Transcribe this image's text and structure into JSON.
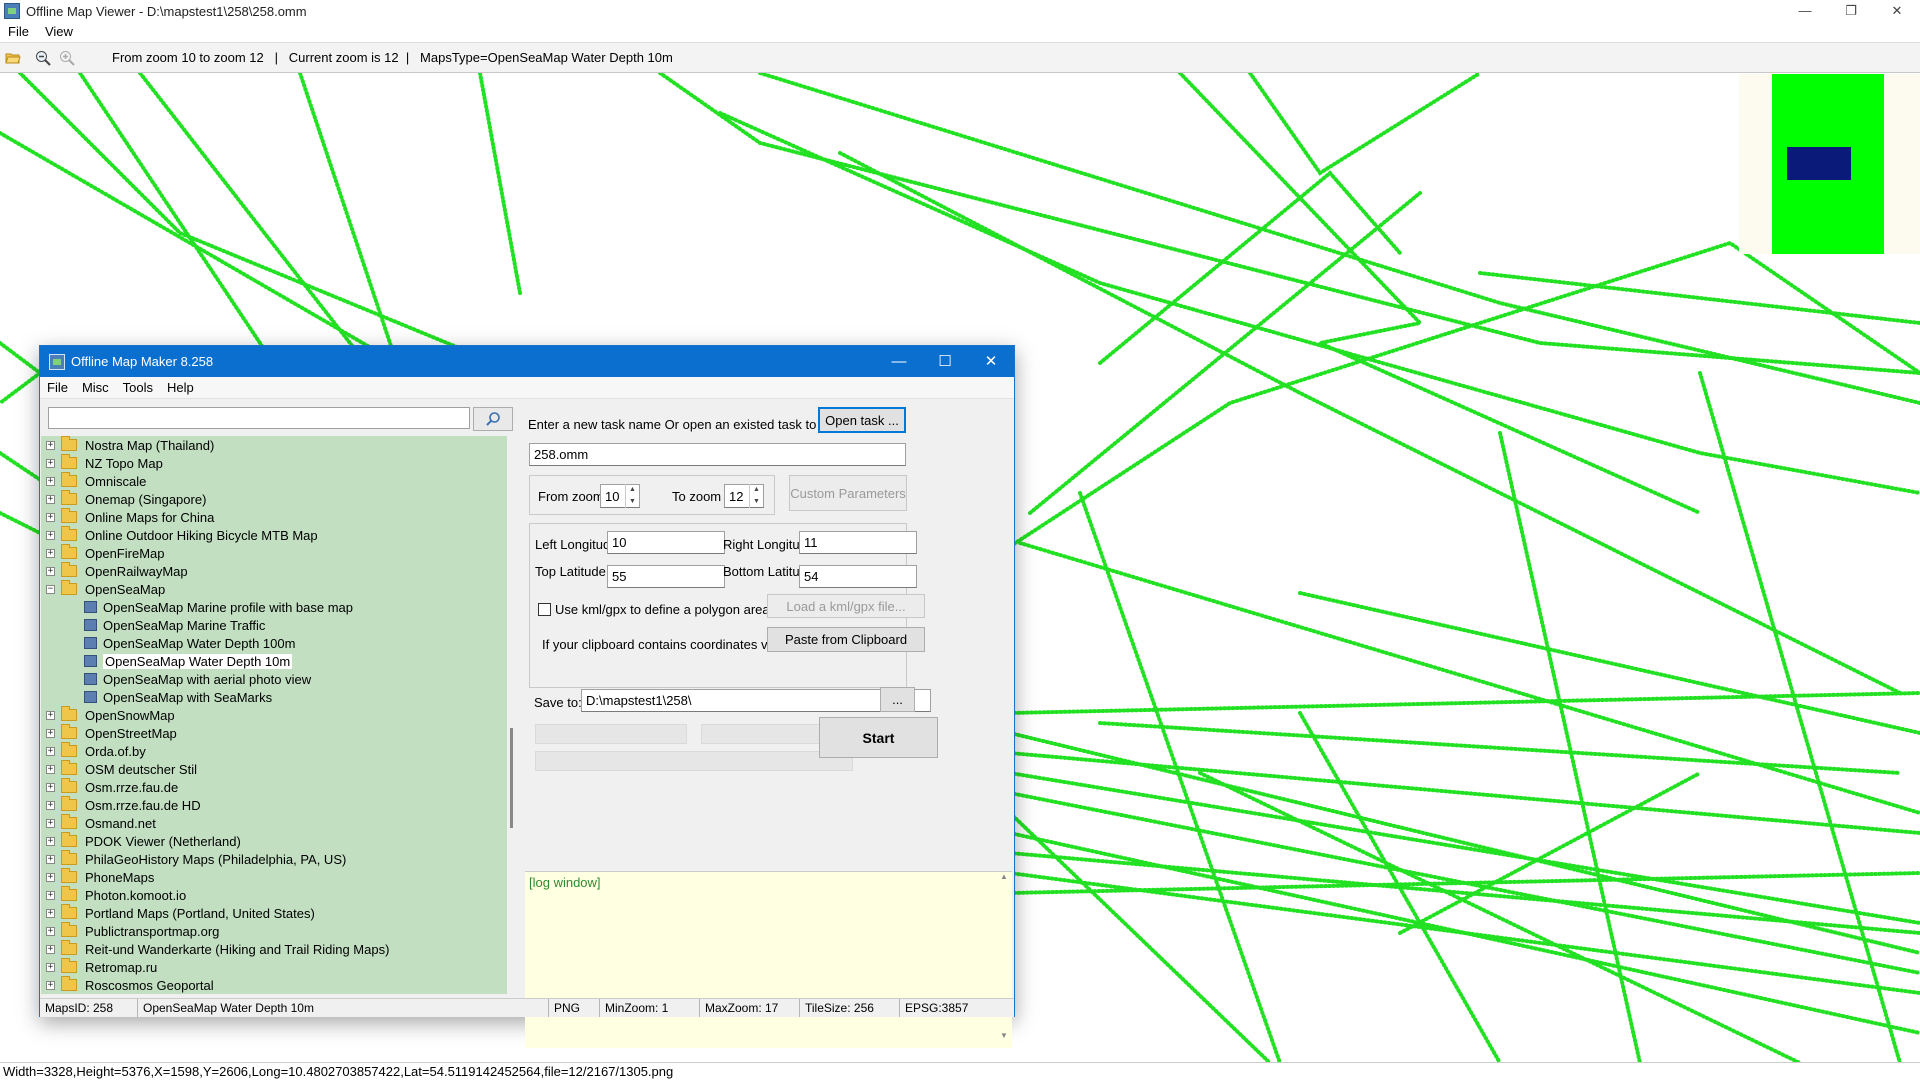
{
  "viewer": {
    "title": "Offline Map Viewer - D:\\mapstest1\\258\\258.omm",
    "menu": [
      "File",
      "View"
    ],
    "toolbar_info": "From zoom 10 to zoom 12   |   Current zoom is 12  |   MapsType=OpenSeaMap Water Depth 10m",
    "status": "Width=3328,Height=5376,X=1598,Y=2606,Long=10.4802703857422,Lat=54.5119142452564,file=12/2167/1305.png",
    "window_controls": [
      "—",
      "❐",
      "✕"
    ]
  },
  "colors": {
    "track": "#22e022",
    "minimap_green": "#00ff00",
    "minimap_blue": "#0a1a78",
    "dialog_title": "#0b6fd0",
    "tree_bg": "#c2dfc2",
    "log_bg": "#ffffe1"
  },
  "maker": {
    "title": "Offline Map Maker 8.258",
    "menu": [
      "File",
      "Misc",
      "Tools",
      "Help"
    ],
    "window_controls": [
      "—",
      "☐",
      "✕"
    ],
    "search": {
      "value": "",
      "placeholder": ""
    },
    "tree": [
      {
        "type": "folder",
        "expander": "+",
        "label": "Nostra Map (Thailand)"
      },
      {
        "type": "folder",
        "expander": "+",
        "label": "NZ Topo Map"
      },
      {
        "type": "folder",
        "expander": "+",
        "label": "Omniscale"
      },
      {
        "type": "folder",
        "expander": "+",
        "label": "Onemap (Singapore)"
      },
      {
        "type": "folder",
        "expander": "+",
        "label": "Online Maps for China"
      },
      {
        "type": "folder",
        "expander": "+",
        "label": "Online Outdoor Hiking Bicycle MTB Map"
      },
      {
        "type": "folder",
        "expander": "+",
        "label": "OpenFireMap"
      },
      {
        "type": "folder",
        "expander": "+",
        "label": "OpenRailwayMap"
      },
      {
        "type": "folder",
        "expander": "−",
        "label": "OpenSeaMap"
      },
      {
        "type": "leaf",
        "label": "OpenSeaMap Marine profile with base map"
      },
      {
        "type": "leaf",
        "label": "OpenSeaMap Marine Traffic"
      },
      {
        "type": "leaf",
        "label": "OpenSeaMap Water Depth 100m"
      },
      {
        "type": "leaf",
        "label": "OpenSeaMap Water Depth 10m",
        "selected": true
      },
      {
        "type": "leaf",
        "label": "OpenSeaMap with aerial photo view"
      },
      {
        "type": "leaf",
        "label": "OpenSeaMap with SeaMarks"
      },
      {
        "type": "folder",
        "expander": "+",
        "label": "OpenSnowMap"
      },
      {
        "type": "folder",
        "expander": "+",
        "label": "OpenStreetMap"
      },
      {
        "type": "folder",
        "expander": "+",
        "label": "Orda.of.by"
      },
      {
        "type": "folder",
        "expander": "+",
        "label": "OSM deutscher Stil"
      },
      {
        "type": "folder",
        "expander": "+",
        "label": "Osm.rrze.fau.de"
      },
      {
        "type": "folder",
        "expander": "+",
        "label": "Osm.rrze.fau.de HD"
      },
      {
        "type": "folder",
        "expander": "+",
        "label": "Osmand.net"
      },
      {
        "type": "folder",
        "expander": "+",
        "label": "PDOK Viewer (Netherland)"
      },
      {
        "type": "folder",
        "expander": "+",
        "label": "PhilaGeoHistory Maps (Philadelphia, PA, US)"
      },
      {
        "type": "folder",
        "expander": "+",
        "label": "PhoneMaps"
      },
      {
        "type": "folder",
        "expander": "+",
        "label": "Photon.komoot.io"
      },
      {
        "type": "folder",
        "expander": "+",
        "label": "Portland Maps (Portland, United States)"
      },
      {
        "type": "folder",
        "expander": "+",
        "label": "Publictransportmap.org"
      },
      {
        "type": "folder",
        "expander": "+",
        "label": "Reit-und Wanderkarte (Hiking and Trail Riding Maps)"
      },
      {
        "type": "folder",
        "expander": "+",
        "label": "Retromap.ru"
      },
      {
        "type": "folder",
        "expander": "+",
        "label": "Roscosmos Geoportal"
      }
    ],
    "task_prompt": "Enter a new task name Or open an existed task to continue:",
    "open_task_label": "Open task ...",
    "task_name": "258.omm",
    "from_zoom_label": "From zoom",
    "from_zoom": "10",
    "to_zoom_label": "To zoom",
    "to_zoom": "12",
    "custom_params_label": "Custom Parameters",
    "left_lon_label": "Left Longitude",
    "left_lon": "10",
    "right_lon_label": "Right Longitude",
    "right_lon": "11",
    "top_lat_label": "Top Latitude",
    "top_lat": "55",
    "bottom_lat_label": "Bottom Latitude",
    "bottom_lat": "54",
    "use_kml_label": "Use kml/gpx to define a polygon area",
    "load_kml_label": "Load a kml/gpx file...",
    "clipboard_prompt": "If your clipboard contains coordinates values:",
    "paste_label": "Paste from Clipboard",
    "save_to_label": "Save to:",
    "save_to": "D:\\mapstest1\\258\\",
    "browse_label": "...",
    "start_label": "Start",
    "log_text": "[log window]",
    "status": [
      "MapsID: 258",
      "OpenSeaMap Water Depth 10m",
      "PNG",
      "MinZoom: 1",
      "MaxZoom: 17",
      "TileSize: 256",
      "EPSG:3857"
    ]
  }
}
